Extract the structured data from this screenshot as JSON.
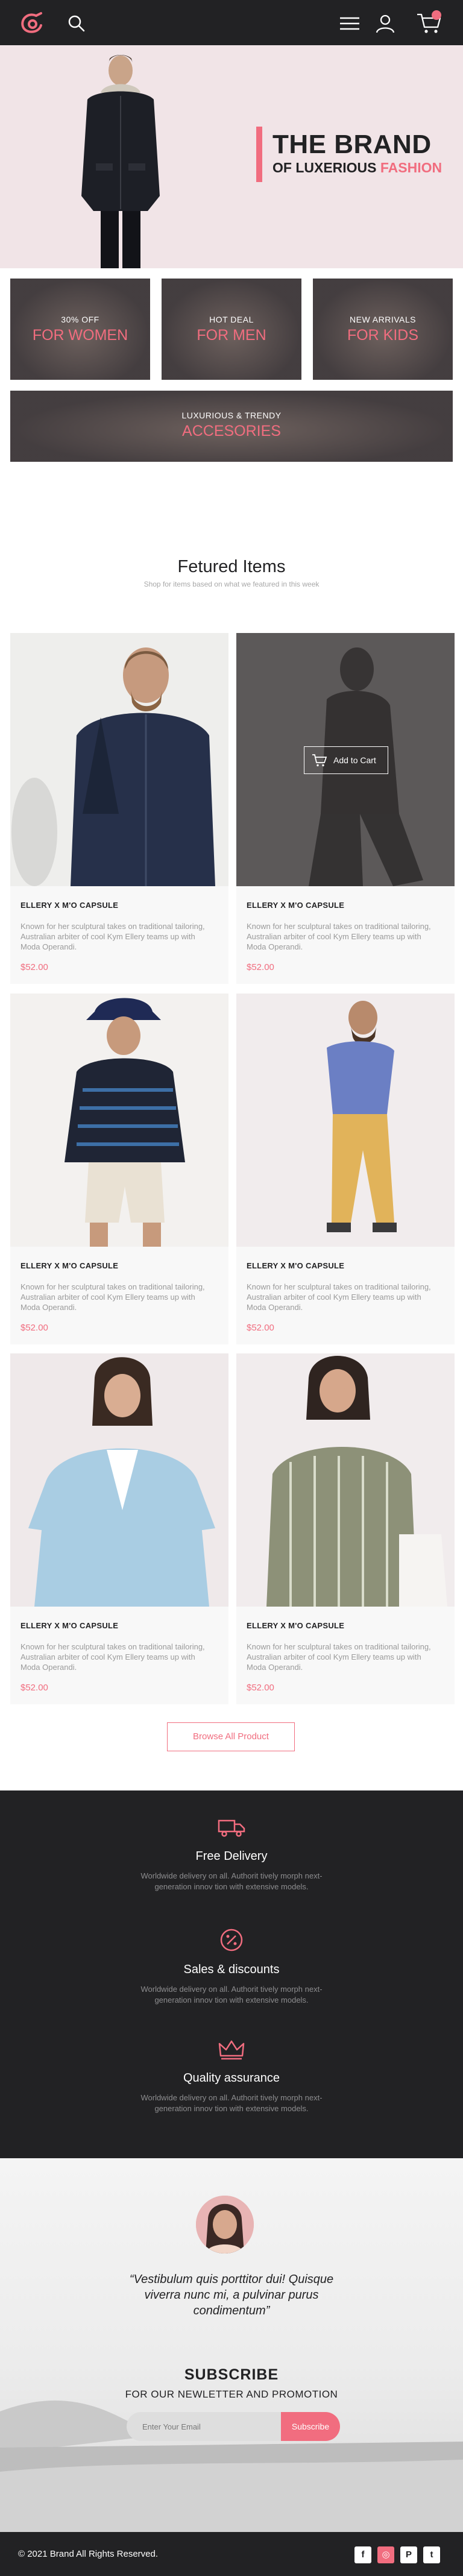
{
  "header": {
    "logo_icon": "brand-logo",
    "icons": [
      "search-icon",
      "menu-icon",
      "user-icon",
      "cart-icon"
    ],
    "accent": "#f16d7f",
    "background": "#222224"
  },
  "hero": {
    "title": "THE BRAND",
    "subtitle_prefix": "OF LUXERIOUS ",
    "subtitle_accent": "FASHION"
  },
  "categories": [
    {
      "small": "30% OFF",
      "big": "FOR WOMEN"
    },
    {
      "small": "HOT DEAL",
      "big": "FOR MEN"
    },
    {
      "small": "NEW ARRIVALS",
      "big": "FOR KIDS"
    },
    {
      "small": "LUXURIOUS & TRENDY",
      "big": "ACCESORIES"
    }
  ],
  "featured": {
    "title": "Fetured Items",
    "subtitle": "Shop for items based on what we featured in this week",
    "add_to_cart": "Add to Cart",
    "browse_label": "Browse All Product",
    "items": [
      {
        "name": "ELLERY X M'O CAPSULE",
        "description": "Known for her sculptural takes on traditional tailoring, Australian arbiter of cool Kym Ellery teams up with Moda Operandi.",
        "price": "$52.00"
      },
      {
        "name": "ELLERY X M'O CAPSULE",
        "description": "Known for her sculptural takes on traditional tailoring, Australian arbiter of cool Kym Ellery teams up with Moda Operandi.",
        "price": "$52.00"
      },
      {
        "name": "ELLERY X M'O CAPSULE",
        "description": "Known for her sculptural takes on traditional tailoring, Australian arbiter of cool Kym Ellery teams up with Moda Operandi.",
        "price": "$52.00"
      },
      {
        "name": "ELLERY X M'O CAPSULE",
        "description": "Known for her sculptural takes on traditional tailoring, Australian arbiter of cool Kym Ellery teams up with Moda Operandi.",
        "price": "$52.00"
      },
      {
        "name": "ELLERY X M'O CAPSULE",
        "description": "Known for her sculptural takes on traditional tailoring, Australian arbiter of cool Kym Ellery teams up with Moda Operandi.",
        "price": "$52.00"
      },
      {
        "name": "ELLERY X M'O CAPSULE",
        "description": "Known for her sculptural takes on traditional tailoring, Australian arbiter of cool Kym Ellery teams up with Moda Operandi.",
        "price": "$52.00"
      }
    ]
  },
  "services": [
    {
      "icon": "truck-icon",
      "title": "Free Delivery",
      "text": "Worldwide delivery on all. Authorit tively morph next-generation innov tion with extensive models."
    },
    {
      "icon": "percent-icon",
      "title": "Sales & discounts",
      "text": "Worldwide delivery on all. Authorit tively morph next-generation innov tion with extensive models."
    },
    {
      "icon": "crown-icon",
      "title": "Quality assurance",
      "text": "Worldwide delivery on all. Authorit tively morph next-generation innov tion with extensive models."
    }
  ],
  "testimonial": {
    "quote": "“Vestibulum quis porttitor dui! Quisque viverra nunc mi, a pulvinar purus condimentum”"
  },
  "subscribe": {
    "title": "SUBSCRIBE",
    "subtitle": "FOR OUR NEWLETTER AND PROMOTION",
    "placeholder": "Enter Your Email",
    "button": "Subscribe"
  },
  "footer": {
    "copyright": "© 2021  Brand  All Rights Reserved.",
    "social": [
      {
        "icon": "facebook-icon",
        "glyph": "f",
        "bg": "#ffffff",
        "fg": "#222224"
      },
      {
        "icon": "instagram-icon",
        "glyph": "◎",
        "bg": "#f16d7f",
        "fg": "#ffffff"
      },
      {
        "icon": "pinterest-icon",
        "glyph": "P",
        "bg": "#ffffff",
        "fg": "#222224"
      },
      {
        "icon": "twitter-icon",
        "glyph": "t",
        "bg": "#ffffff",
        "fg": "#222224"
      }
    ]
  }
}
